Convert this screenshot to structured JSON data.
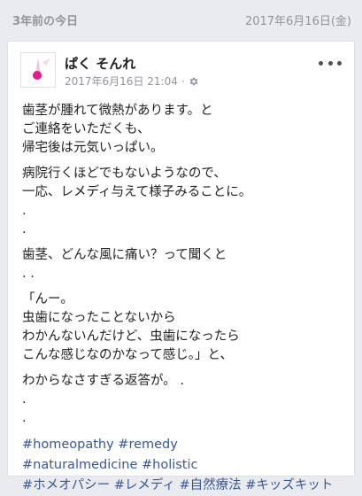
{
  "memory": {
    "title": "3年前の今日",
    "date": "2017年6月16日(金)"
  },
  "post": {
    "author": "ぱく そんれ",
    "timestamp": "2017年6月16日 21:04",
    "separator": "·",
    "privacy_icon": "gear-icon",
    "paragraphs": [
      [
        "歯茎が腫れて微熱があります。と",
        "ご連絡をいただくも、",
        "帰宅後は元気いっぱい。"
      ],
      [
        "病院行くほどでもないようなので、",
        "一応、レメディ与えて様子みることに。",
        ".",
        "."
      ],
      [
        "歯茎、どんな風に痛い？って聞くと",
        ". ."
      ],
      [
        "「んー。",
        "虫歯になったことないから",
        "わかんないんだけど、虫歯になったら",
        "こんな感じなのかなって感じ。」と、"
      ],
      [
        "わからなさすぎる返答が。 .",
        ".",
        "."
      ]
    ],
    "hashtag_lines": [
      [
        "#homeopathy",
        "#remedy"
      ],
      [
        "#naturalmedicine",
        "#holistic"
      ],
      [
        "#ホメオパシー",
        "#レメディ",
        "#自然療法",
        "#キッズキット"
      ]
    ]
  },
  "colors": {
    "link": "#365899",
    "meta": "#90949c",
    "avatar_accent": "#e8188a"
  }
}
